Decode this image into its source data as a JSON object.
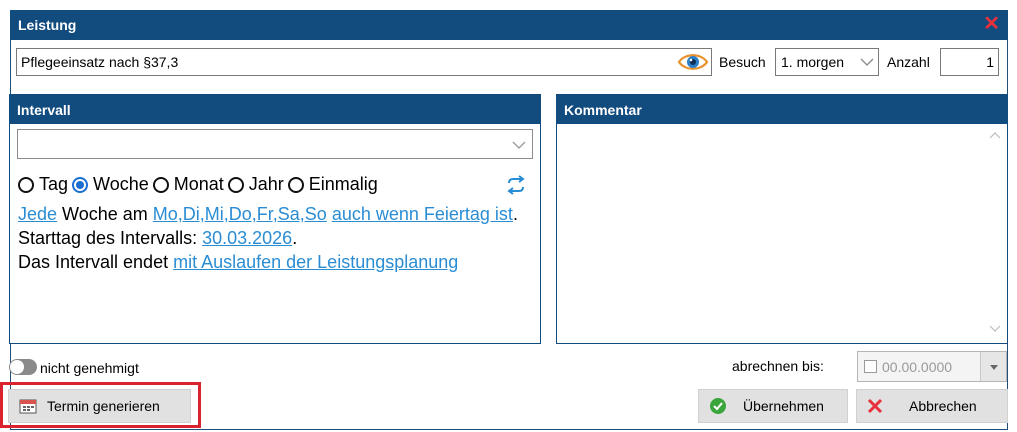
{
  "dialog": {
    "title": "Leistung",
    "close_icon": "close-icon",
    "colors": {
      "header": "#124c7f",
      "close": "#e8303a",
      "link": "#2a8dd4",
      "highlight": "#d9242e"
    }
  },
  "service": {
    "value": "Pflegeeinsatz nach §37,3",
    "icon": "eye-icon"
  },
  "besuch": {
    "label": "Besuch",
    "value": "1. morgen"
  },
  "anzahl": {
    "label": "Anzahl",
    "value": "1"
  },
  "intervall": {
    "title": "Intervall",
    "select_value": "",
    "radios": [
      {
        "label": "Tag",
        "checked": false
      },
      {
        "label": "Woche",
        "checked": true
      },
      {
        "label": "Monat",
        "checked": false
      },
      {
        "label": "Jahr",
        "checked": false
      },
      {
        "label": "Einmalig",
        "checked": false
      }
    ],
    "repeat_icon": "repeat-icon",
    "line1": {
      "link_jede": "Jede",
      "text_woche": " Woche am ",
      "link_days": "Mo,Di,Mi,Do,Fr,Sa,So",
      "link_feiertag": "auch wenn Feiertag ist",
      "end": "."
    },
    "line2": {
      "text": "Starttag des Intervalls: ",
      "link_date": "30.03.2026",
      "end": "."
    },
    "line3": {
      "text": "Das Intervall endet ",
      "link": "mit Auslaufen der Leistungsplanung"
    }
  },
  "kommentar": {
    "title": "Kommentar",
    "value": ""
  },
  "genehmigt": {
    "label": "nicht genehmigt",
    "on": false
  },
  "abrechnen": {
    "label": "abrechnen bis:",
    "value": "00.00.0000",
    "checked": false
  },
  "buttons": {
    "termin": {
      "label": "Termin generieren",
      "icon": "calendar-icon"
    },
    "uebernehmen": {
      "label": "Übernehmen",
      "icon": "check-circle-icon"
    },
    "abbrechen": {
      "label": "Abbrechen",
      "icon": "cross-icon"
    }
  }
}
